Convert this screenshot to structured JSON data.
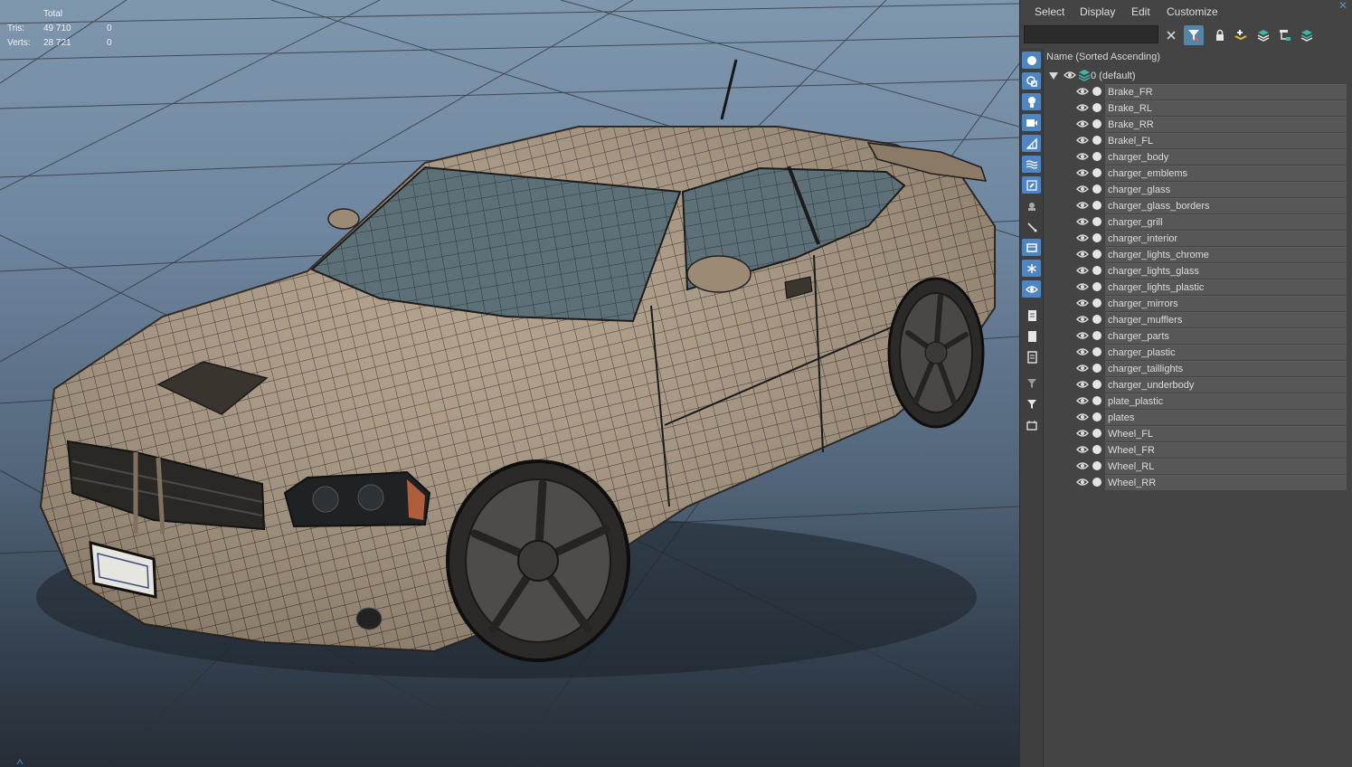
{
  "stats": {
    "header": "Total",
    "rows": [
      {
        "label": "Tris:",
        "total": "49 710",
        "selected": "0"
      },
      {
        "label": "Verts:",
        "total": "28 721",
        "selected": "0"
      }
    ]
  },
  "scene_explorer": {
    "menu": [
      "Select",
      "Display",
      "Edit",
      "Customize"
    ],
    "search": {
      "value": "",
      "placeholder": ""
    },
    "column_header": "Name (Sorted Ascending)",
    "root_layer": "0 (default)",
    "objects": [
      "Brake_FR",
      "Brake_RL",
      "Brake_RR",
      "Brakel_FL",
      "charger_body",
      "charger_emblems",
      "charger_glass",
      "charger_glass_borders",
      "charger_grill",
      "charger_interior",
      "charger_lights_chrome",
      "charger_lights_glass",
      "charger_lights_plastic",
      "charger_mirrors",
      "charger_mufflers",
      "charger_parts",
      "charger_plastic",
      "charger_taillights",
      "charger_underbody",
      "plate_plastic",
      "plates",
      "Wheel_FL",
      "Wheel_FR",
      "Wheel_RL",
      "Wheel_RR"
    ],
    "toolbar_icons": [
      "clear-search-icon",
      "filter-icon",
      "lock-icon",
      "add-layer-icon",
      "layer-stack-icon",
      "hierarchy-icon",
      "layers-icon"
    ],
    "side_icons": [
      "geometry-icon",
      "shapes-icon",
      "light-icon",
      "camera-icon",
      "helper-icon",
      "spacewarp-icon",
      "bone-icon",
      "container-icon",
      "particle-icon",
      "frozen-icon",
      "snowflake-icon",
      "eye-icon",
      "document-icon",
      "blank-icon",
      "list-icon",
      "filter-funnel-icon",
      "funnel-icon",
      "checkbox-icon"
    ]
  },
  "colors": {
    "accent": "#4f86c2",
    "panel_bg": "#444444",
    "row_bg": "#575757",
    "mesh": "#a8957e",
    "viewport_top": "#7f97ad"
  }
}
